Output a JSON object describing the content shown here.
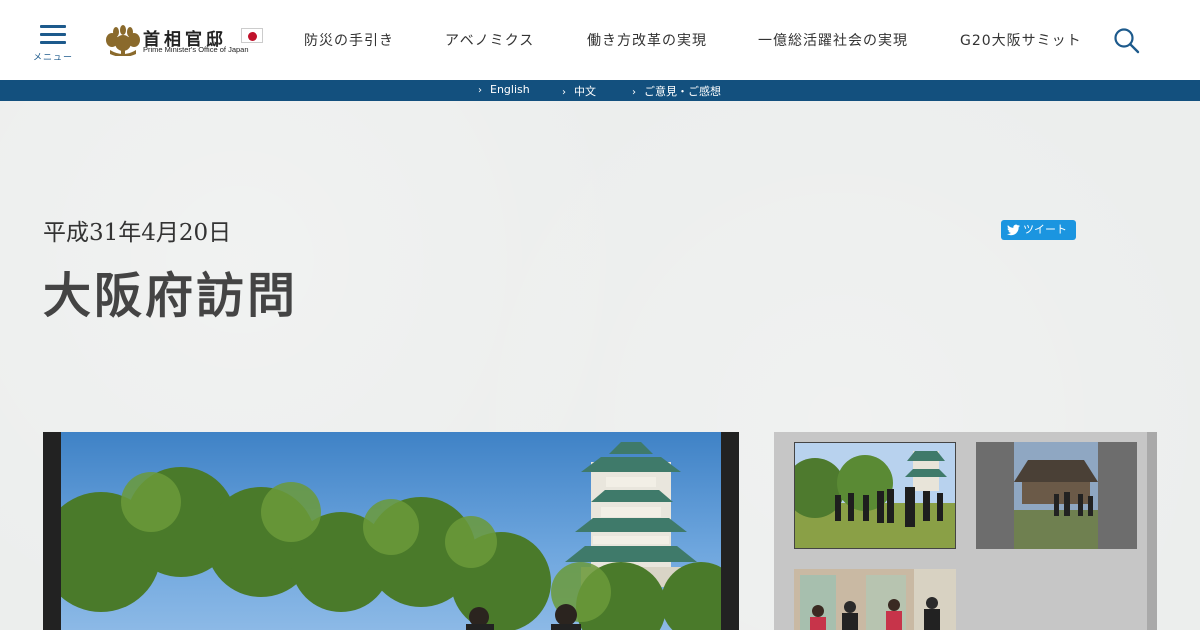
{
  "header": {
    "menu_label": "メニュー",
    "logo_title": "首相官邸",
    "logo_subtitle": "Prime Minister's Office of Japan",
    "nav": [
      {
        "label": "防災の手引き"
      },
      {
        "label": "アベノミクス"
      },
      {
        "label": "働き方改革の実現"
      },
      {
        "label": "一億総活躍社会の実現"
      },
      {
        "label": "G20大阪サミット"
      }
    ],
    "search_icon": "search-icon",
    "menu_icon": "hamburger-icon"
  },
  "subbar": {
    "links": [
      {
        "label": "English"
      },
      {
        "label": "中文"
      },
      {
        "label": "ご意見・ご感想"
      }
    ]
  },
  "article": {
    "date": "平成31年4月20日",
    "title": "大阪府訪問",
    "tweet_label": "ツイート"
  },
  "colors": {
    "brand_blue": "#13507e",
    "tweet_blue": "#1b95e0",
    "background": "#eceeed"
  }
}
